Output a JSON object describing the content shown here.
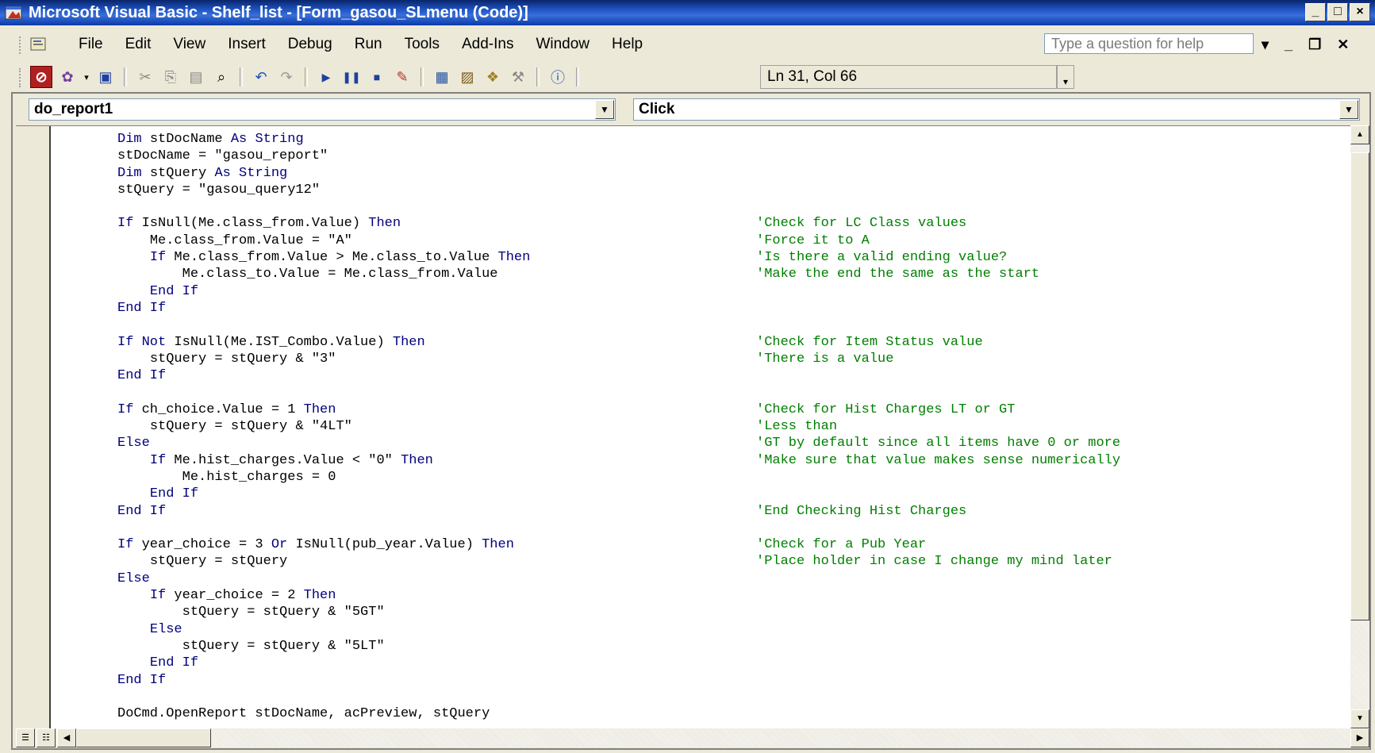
{
  "window": {
    "title": "Microsoft Visual Basic - Shelf_list - [Form_gasou_SLmenu (Code)]"
  },
  "menu": {
    "items": [
      {
        "label": "File"
      },
      {
        "label": "Edit"
      },
      {
        "label": "View"
      },
      {
        "label": "Insert"
      },
      {
        "label": "Debug"
      },
      {
        "label": "Run"
      },
      {
        "label": "Tools"
      },
      {
        "label": "Add-Ins"
      },
      {
        "label": "Window"
      },
      {
        "label": "Help"
      }
    ],
    "help_placeholder": "Type a question for help"
  },
  "toolbar": {
    "position": "Ln 31, Col 66"
  },
  "code_window": {
    "object_combo": "do_report1",
    "procedure_combo": "Click",
    "lines": [
      {
        "indent": "",
        "parts": [
          [
            "kw",
            "Dim "
          ],
          [
            "",
            "stDocName "
          ],
          [
            "kw",
            "As String"
          ]
        ],
        "comment": ""
      },
      {
        "indent": "",
        "parts": [
          [
            "",
            "stDocName = \"gasou_report\""
          ]
        ],
        "comment": ""
      },
      {
        "indent": "",
        "parts": [
          [
            "kw",
            "Dim "
          ],
          [
            "",
            "stQuery "
          ],
          [
            "kw",
            "As String"
          ]
        ],
        "comment": ""
      },
      {
        "indent": "",
        "parts": [
          [
            "",
            "stQuery = \"gasou_query12\""
          ]
        ],
        "comment": ""
      },
      {
        "indent": "",
        "parts": [],
        "comment": ""
      },
      {
        "indent": "",
        "parts": [
          [
            "kw",
            "If "
          ],
          [
            "",
            "IsNull(Me.class_from.Value) "
          ],
          [
            "kw",
            "Then"
          ]
        ],
        "comment": "'Check for LC Class values"
      },
      {
        "indent": "    ",
        "parts": [
          [
            "",
            "Me.class_from.Value = \"A\""
          ]
        ],
        "comment": "'Force it to A"
      },
      {
        "indent": "    ",
        "parts": [
          [
            "kw",
            "If "
          ],
          [
            "",
            "Me.class_from.Value > Me.class_to.Value "
          ],
          [
            "kw",
            "Then"
          ]
        ],
        "comment": "'Is there a valid ending value?"
      },
      {
        "indent": "        ",
        "parts": [
          [
            "",
            "Me.class_to.Value = Me.class_from.Value"
          ]
        ],
        "comment": "'Make the end the same as the start"
      },
      {
        "indent": "    ",
        "parts": [
          [
            "kw",
            "End If"
          ]
        ],
        "comment": ""
      },
      {
        "indent": "",
        "parts": [
          [
            "kw",
            "End If"
          ]
        ],
        "comment": ""
      },
      {
        "indent": "",
        "parts": [],
        "comment": ""
      },
      {
        "indent": "",
        "parts": [
          [
            "kw",
            "If Not "
          ],
          [
            "",
            "IsNull(Me.IST_Combo.Value) "
          ],
          [
            "kw",
            "Then"
          ]
        ],
        "comment": "'Check for Item Status value"
      },
      {
        "indent": "    ",
        "parts": [
          [
            "",
            "stQuery = stQuery & \"3\""
          ]
        ],
        "comment": "'There is a value"
      },
      {
        "indent": "",
        "parts": [
          [
            "kw",
            "End If"
          ]
        ],
        "comment": ""
      },
      {
        "indent": "",
        "parts": [],
        "comment": ""
      },
      {
        "indent": "",
        "parts": [
          [
            "kw",
            "If "
          ],
          [
            "",
            "ch_choice.Value = 1 "
          ],
          [
            "kw",
            "Then"
          ]
        ],
        "comment": "'Check for Hist Charges LT or GT"
      },
      {
        "indent": "    ",
        "parts": [
          [
            "",
            "stQuery = stQuery & \"4LT\""
          ]
        ],
        "comment": "'Less than"
      },
      {
        "indent": "",
        "parts": [
          [
            "kw",
            "Else"
          ]
        ],
        "comment": "'GT by default since all items have 0 or more"
      },
      {
        "indent": "    ",
        "parts": [
          [
            "kw",
            "If "
          ],
          [
            "",
            "Me.hist_charges.Value < \"0\" "
          ],
          [
            "kw",
            "Then"
          ]
        ],
        "comment": "'Make sure that value makes sense numerically"
      },
      {
        "indent": "        ",
        "parts": [
          [
            "",
            "Me.hist_charges = 0"
          ]
        ],
        "comment": ""
      },
      {
        "indent": "    ",
        "parts": [
          [
            "kw",
            "End If"
          ]
        ],
        "comment": ""
      },
      {
        "indent": "",
        "parts": [
          [
            "kw",
            "End If"
          ]
        ],
        "comment": "'End Checking Hist Charges"
      },
      {
        "indent": "",
        "parts": [],
        "comment": ""
      },
      {
        "indent": "",
        "parts": [
          [
            "kw",
            "If "
          ],
          [
            "",
            "year_choice = 3 "
          ],
          [
            "kw",
            "Or "
          ],
          [
            "",
            "IsNull(pub_year.Value) "
          ],
          [
            "kw",
            "Then"
          ]
        ],
        "comment": "'Check for a Pub Year"
      },
      {
        "indent": "    ",
        "parts": [
          [
            "",
            "stQuery = stQuery"
          ]
        ],
        "comment": "'Place holder in case I change my mind later"
      },
      {
        "indent": "",
        "parts": [
          [
            "kw",
            "Else"
          ]
        ],
        "comment": ""
      },
      {
        "indent": "    ",
        "parts": [
          [
            "kw",
            "If "
          ],
          [
            "",
            "year_choice = 2 "
          ],
          [
            "kw",
            "Then"
          ]
        ],
        "comment": ""
      },
      {
        "indent": "        ",
        "parts": [
          [
            "",
            "stQuery = stQuery & \"5GT\""
          ]
        ],
        "comment": ""
      },
      {
        "indent": "    ",
        "parts": [
          [
            "kw",
            "Else"
          ]
        ],
        "comment": ""
      },
      {
        "indent": "        ",
        "parts": [
          [
            "",
            "stQuery = stQuery & \"5LT\""
          ]
        ],
        "comment": ""
      },
      {
        "indent": "    ",
        "parts": [
          [
            "kw",
            "End If"
          ]
        ],
        "comment": ""
      },
      {
        "indent": "",
        "parts": [
          [
            "kw",
            "End If"
          ]
        ],
        "comment": ""
      },
      {
        "indent": "",
        "parts": [],
        "comment": ""
      },
      {
        "indent": "",
        "parts": [
          [
            "",
            "DoCmd.OpenReport stDocName, acPreview, stQuery"
          ]
        ],
        "comment": ""
      }
    ]
  },
  "colors": {
    "keyword": "#00007f",
    "comment": "#007f00",
    "title_bar": "#0a246a"
  }
}
